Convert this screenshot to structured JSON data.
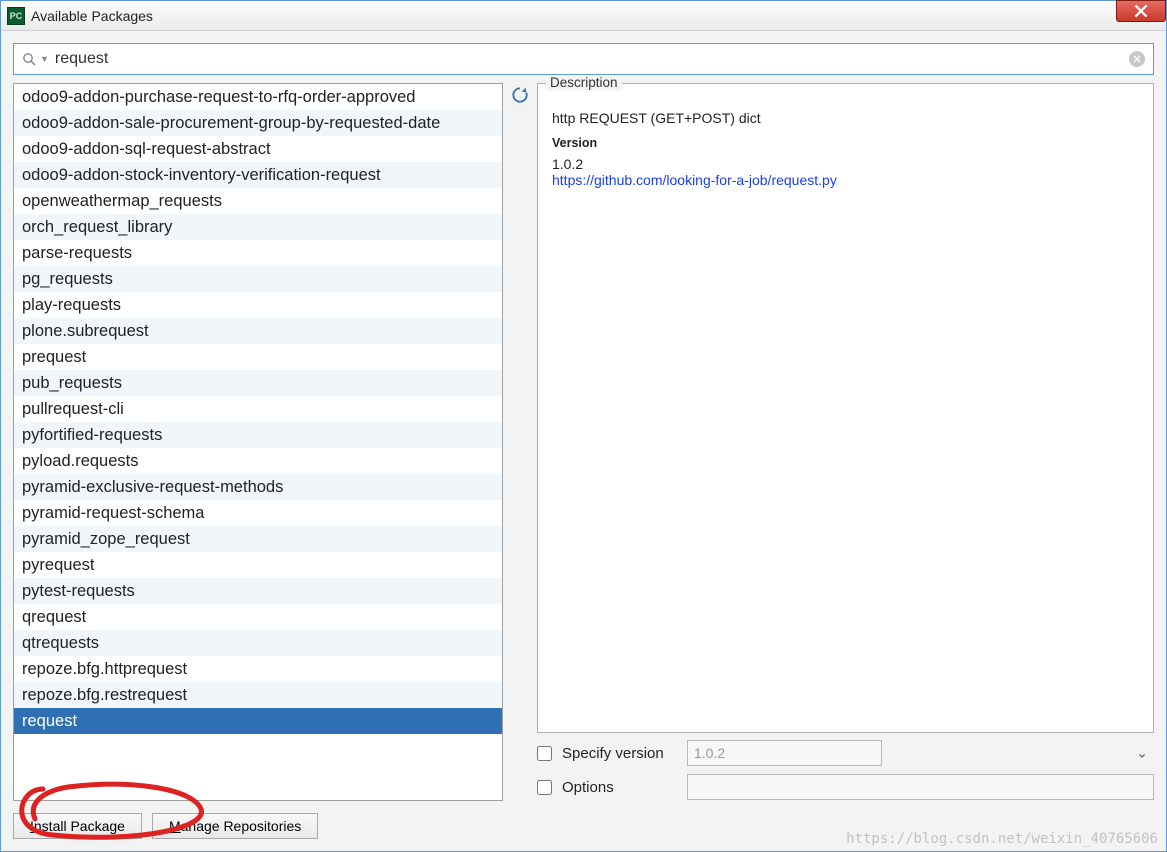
{
  "window": {
    "title": "Available Packages"
  },
  "search": {
    "value": "request"
  },
  "packages": [
    "odoo9-addon-purchase-request-to-rfq-order-approved",
    "odoo9-addon-sale-procurement-group-by-requested-date",
    "odoo9-addon-sql-request-abstract",
    "odoo9-addon-stock-inventory-verification-request",
    "openweathermap_requests",
    "orch_request_library",
    "parse-requests",
    "pg_requests",
    "play-requests",
    "plone.subrequest",
    "prequest",
    "pub_requests",
    "pullrequest-cli",
    "pyfortified-requests",
    "pyload.requests",
    "pyramid-exclusive-request-methods",
    "pyramid-request-schema",
    "pyramid_zope_request",
    "pyrequest",
    "pytest-requests",
    "qrequest",
    "qtrequests",
    "repoze.bfg.httprequest",
    "repoze.bfg.restrequest",
    "request"
  ],
  "selected_index": 24,
  "description": {
    "label": "Description",
    "summary": "http REQUEST (GET+POST) dict",
    "version_label": "Version",
    "version": "1.0.2",
    "link": "https://github.com/looking-for-a-job/request.py"
  },
  "options": {
    "specify_version_label": "Specify version",
    "specify_version_value": "1.0.2",
    "options_label": "Options",
    "options_value": ""
  },
  "buttons": {
    "install": "Install Package",
    "manage": "Manage Repositories"
  },
  "watermark": "https://blog.csdn.net/weixin_40765606"
}
